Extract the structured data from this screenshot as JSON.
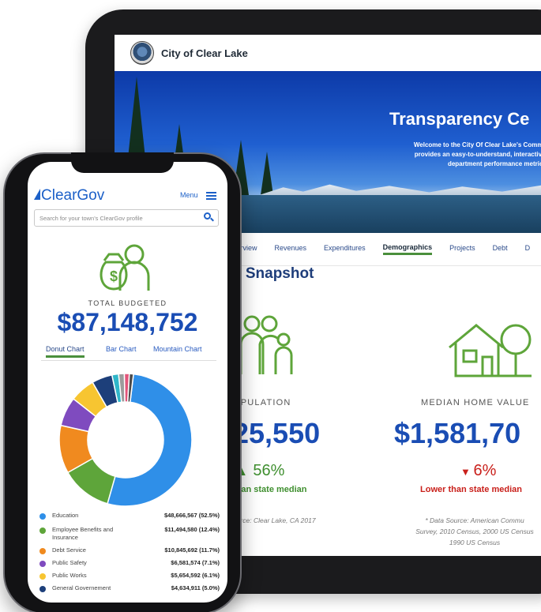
{
  "tablet": {
    "city_name": "City of Clear Lake",
    "hero_title": "Transparency Ce",
    "hero_subtitle_lines": [
      "Welcome to the City Of Clear Lake's Community Transp",
      "provides an easy-to-understand, interactive view of our",
      "department performance metrics, demograp"
    ],
    "nav": [
      "verview",
      "Revenues",
      "Expenditures",
      "Demographics",
      "Projects",
      "Debt",
      "D"
    ],
    "active_nav": "Demographics",
    "section_title": "c Snapshot",
    "stats": [
      {
        "label": "OPULATION",
        "value": "25,550",
        "change": "56%",
        "change_direction": "up",
        "note": "than state median",
        "source": [
          "ource: Clear Lake, CA 2017"
        ]
      },
      {
        "label": "MEDIAN HOME VALUE",
        "value": "$1,581,70",
        "change": "6%",
        "change_direction": "down",
        "note": "Lower than state median",
        "source": [
          "* Data Source: American Commu",
          "Survey, 2010 Census, 2000 US Census",
          "1990 US Census"
        ]
      }
    ],
    "colors": {
      "primary_blue": "#1a4db4",
      "green": "#3f8f2f",
      "red": "#c9201b"
    }
  },
  "phone": {
    "logo": "ClearGov",
    "menu_label": "Menu",
    "search_placeholder": "Search for your town's ClearGov profile",
    "total_label": "TOTAL BUDGETED",
    "total_value": "$87,148,752",
    "tabs": [
      "Donut Chart",
      "Bar Chart",
      "Mountain Chart"
    ],
    "active_tab": "Donut Chart",
    "legend": [
      {
        "name": "Education",
        "value": "$48,666,567 (52.5%)",
        "color": "#2f8fe8"
      },
      {
        "name": "Employee Benefits and Insurance",
        "value": "$11,494,580 (12.4%)",
        "color": "#5ea53a"
      },
      {
        "name": "Debt Service",
        "value": "$10,845,692 (11.7%)",
        "color": "#f08a1f"
      },
      {
        "name": "Public Safety",
        "value": "$6,581,574 (7.1%)",
        "color": "#7f4bbf"
      },
      {
        "name": "Public Works",
        "value": "$5,654,592 (6.1%)",
        "color": "#f7c531"
      },
      {
        "name": "General Governement",
        "value": "$4,634,911 (5.0%)",
        "color": "#1d3f7a"
      }
    ]
  },
  "chart_data": {
    "type": "pie",
    "title": "",
    "categories": [
      "Education",
      "Employee Benefits and Insurance",
      "Debt Service",
      "Public Safety",
      "Public Works",
      "General Governement",
      "",
      "",
      "",
      ""
    ],
    "values": [
      52.5,
      12.4,
      11.7,
      7.1,
      6.1,
      5.0,
      1.6,
      1.4,
      1.2,
      1.0
    ],
    "colors": [
      "#2f8fe8",
      "#5ea53a",
      "#f08a1f",
      "#7f4bbf",
      "#f7c531",
      "#1d3f7a",
      "#2fb6c9",
      "#9c9c9c",
      "#e2557a",
      "#4a4a4a"
    ],
    "units": "percent"
  }
}
